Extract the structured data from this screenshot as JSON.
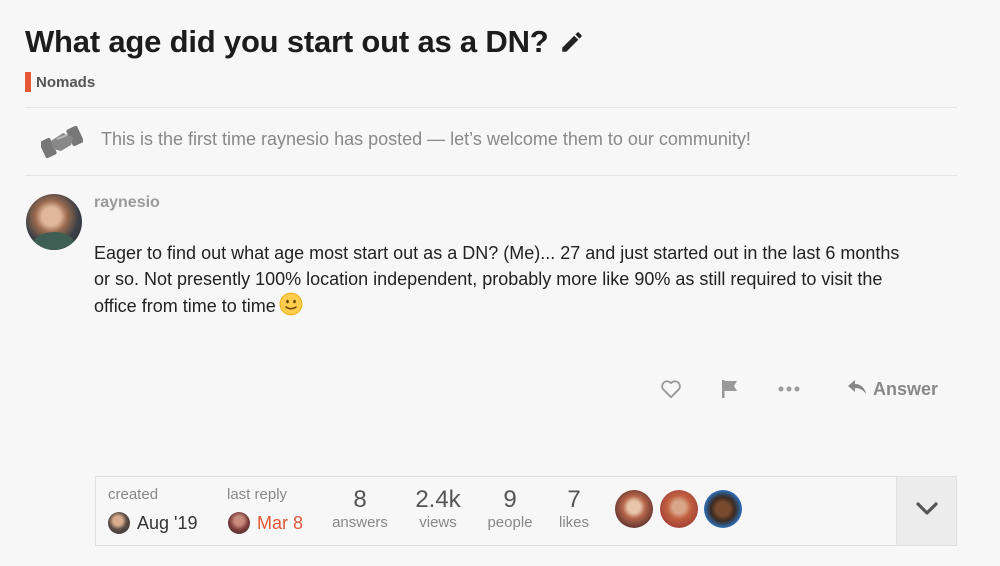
{
  "topic": {
    "title": "What age did you start out as a DN?",
    "category": "Nomads",
    "category_color": "#e45735"
  },
  "notice": {
    "text": "This is the first time raynesio has posted — let’s welcome them to our community!",
    "icon": "handshake-icon"
  },
  "post": {
    "username": "raynesio",
    "lines": [
      "Eager to find out what age most start out as a DN? (Me)... 27 and just started out in the last 6 months",
      "or so. Not presently 100% location independent, probably more like 90% as still required to visit the",
      "office from time to time"
    ],
    "emoji": "slightly-smiling-face-icon"
  },
  "actions": {
    "like_icon": "heart-icon",
    "flag_icon": "flag-icon",
    "more_icon": "ellipsis-icon",
    "answer_label": "Answer"
  },
  "summary": {
    "created_label": "created",
    "created_date": "Aug '19",
    "last_reply_label": "last reply",
    "last_reply_date": "Mar 8",
    "stats": [
      {
        "value": "8",
        "label": "answers"
      },
      {
        "value": "2.4k",
        "label": "views"
      },
      {
        "value": "9",
        "label": "people"
      },
      {
        "value": "7",
        "label": "likes"
      }
    ],
    "expand_icon": "chevron-down-icon"
  }
}
